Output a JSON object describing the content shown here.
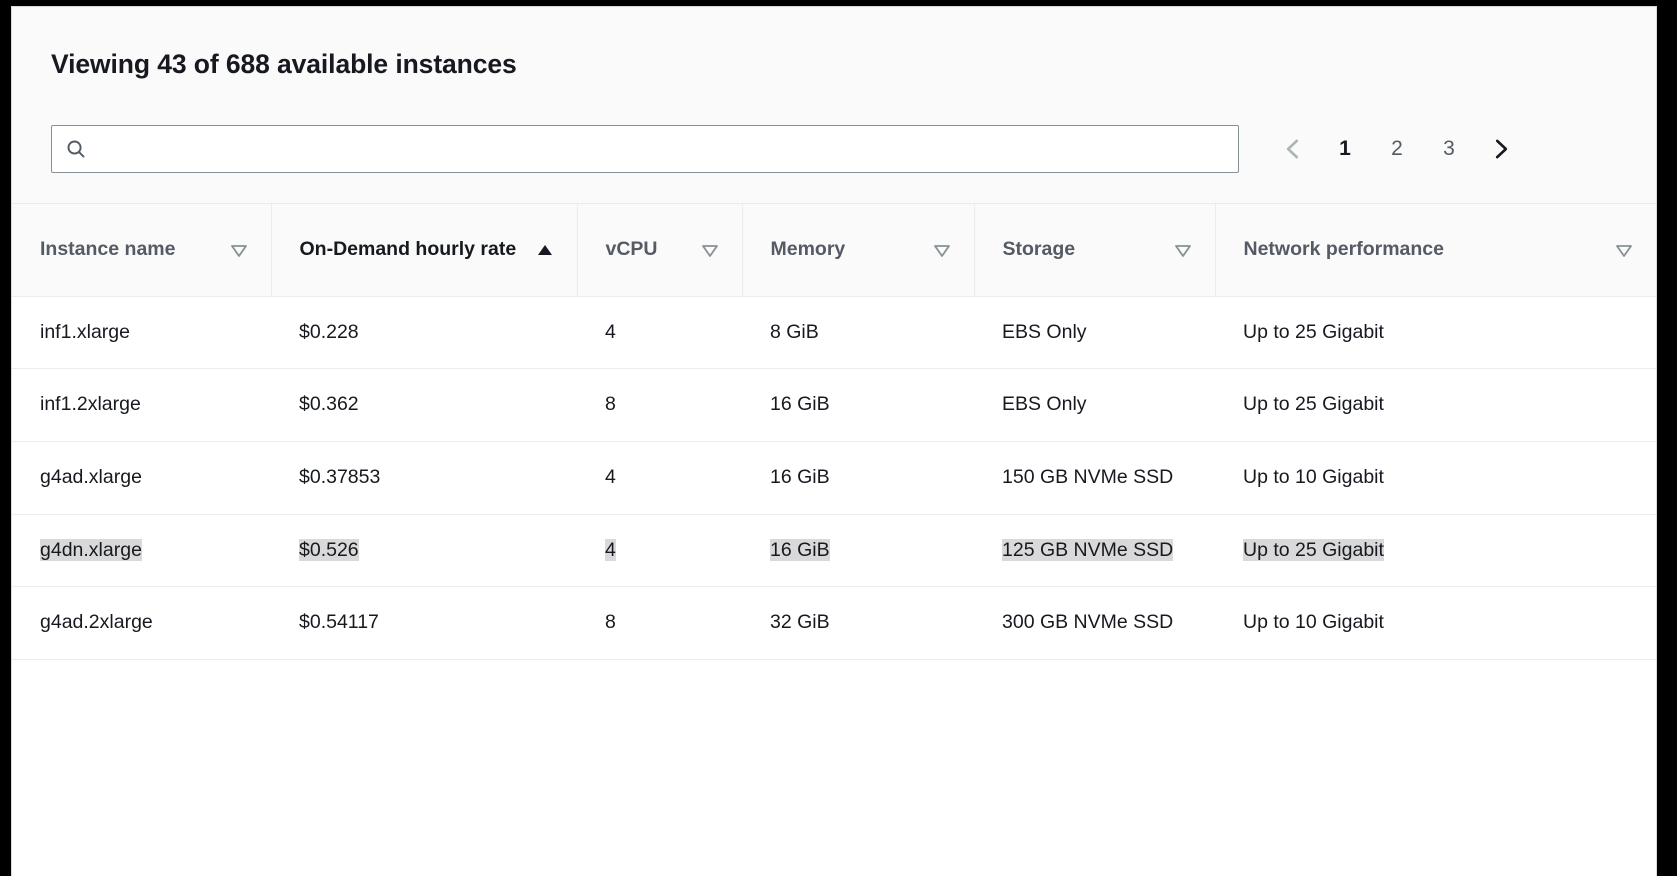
{
  "panel": {
    "title": "Viewing 43 of 688 available instances"
  },
  "search": {
    "value": "",
    "placeholder": "",
    "icon": "search-icon"
  },
  "pagination": {
    "prev_icon": "chevron-left-icon",
    "next_icon": "chevron-right-icon",
    "prev_enabled": false,
    "next_enabled": true,
    "pages": [
      "1",
      "2",
      "3"
    ],
    "current_page": "1"
  },
  "table": {
    "columns": [
      {
        "label": "Instance name",
        "sort": "none",
        "sort_icon": "triangle-down-outline-icon"
      },
      {
        "label": "On-Demand hourly rate",
        "sort": "ascending",
        "sort_icon": "triangle-up-filled-icon"
      },
      {
        "label": "vCPU",
        "sort": "none",
        "sort_icon": "triangle-down-outline-icon"
      },
      {
        "label": "Memory",
        "sort": "none",
        "sort_icon": "triangle-down-outline-icon"
      },
      {
        "label": "Storage",
        "sort": "none",
        "sort_icon": "triangle-down-outline-icon"
      },
      {
        "label": "Network performance",
        "sort": "none",
        "sort_icon": "triangle-down-outline-icon"
      }
    ],
    "rows": [
      {
        "selected": false,
        "cells": [
          "inf1.xlarge",
          "$0.228",
          "4",
          "8 GiB",
          "EBS Only",
          "Up to 25 Gigabit"
        ]
      },
      {
        "selected": false,
        "cells": [
          "inf1.2xlarge",
          "$0.362",
          "8",
          "16 GiB",
          "EBS Only",
          "Up to 25 Gigabit"
        ]
      },
      {
        "selected": false,
        "cells": [
          "g4ad.xlarge",
          "$0.37853",
          "4",
          "16 GiB",
          "150 GB NVMe SSD",
          "Up to 10 Gigabit"
        ]
      },
      {
        "selected": true,
        "cells": [
          "g4dn.xlarge",
          "$0.526",
          "4",
          "16 GiB",
          "125 GB NVMe SSD",
          "Up to 25 Gigabit"
        ]
      },
      {
        "selected": false,
        "cells": [
          "g4ad.2xlarge",
          "$0.54117",
          "8",
          "32 GiB",
          "300 GB NVMe SSD",
          "Up to 10 Gigabit"
        ]
      }
    ]
  },
  "colors": {
    "selection_highlight": "#d9d9d9",
    "header_text": "#545b64",
    "body_text": "#16191f",
    "panel_background": "#fafafa",
    "border": "#eaeded"
  }
}
